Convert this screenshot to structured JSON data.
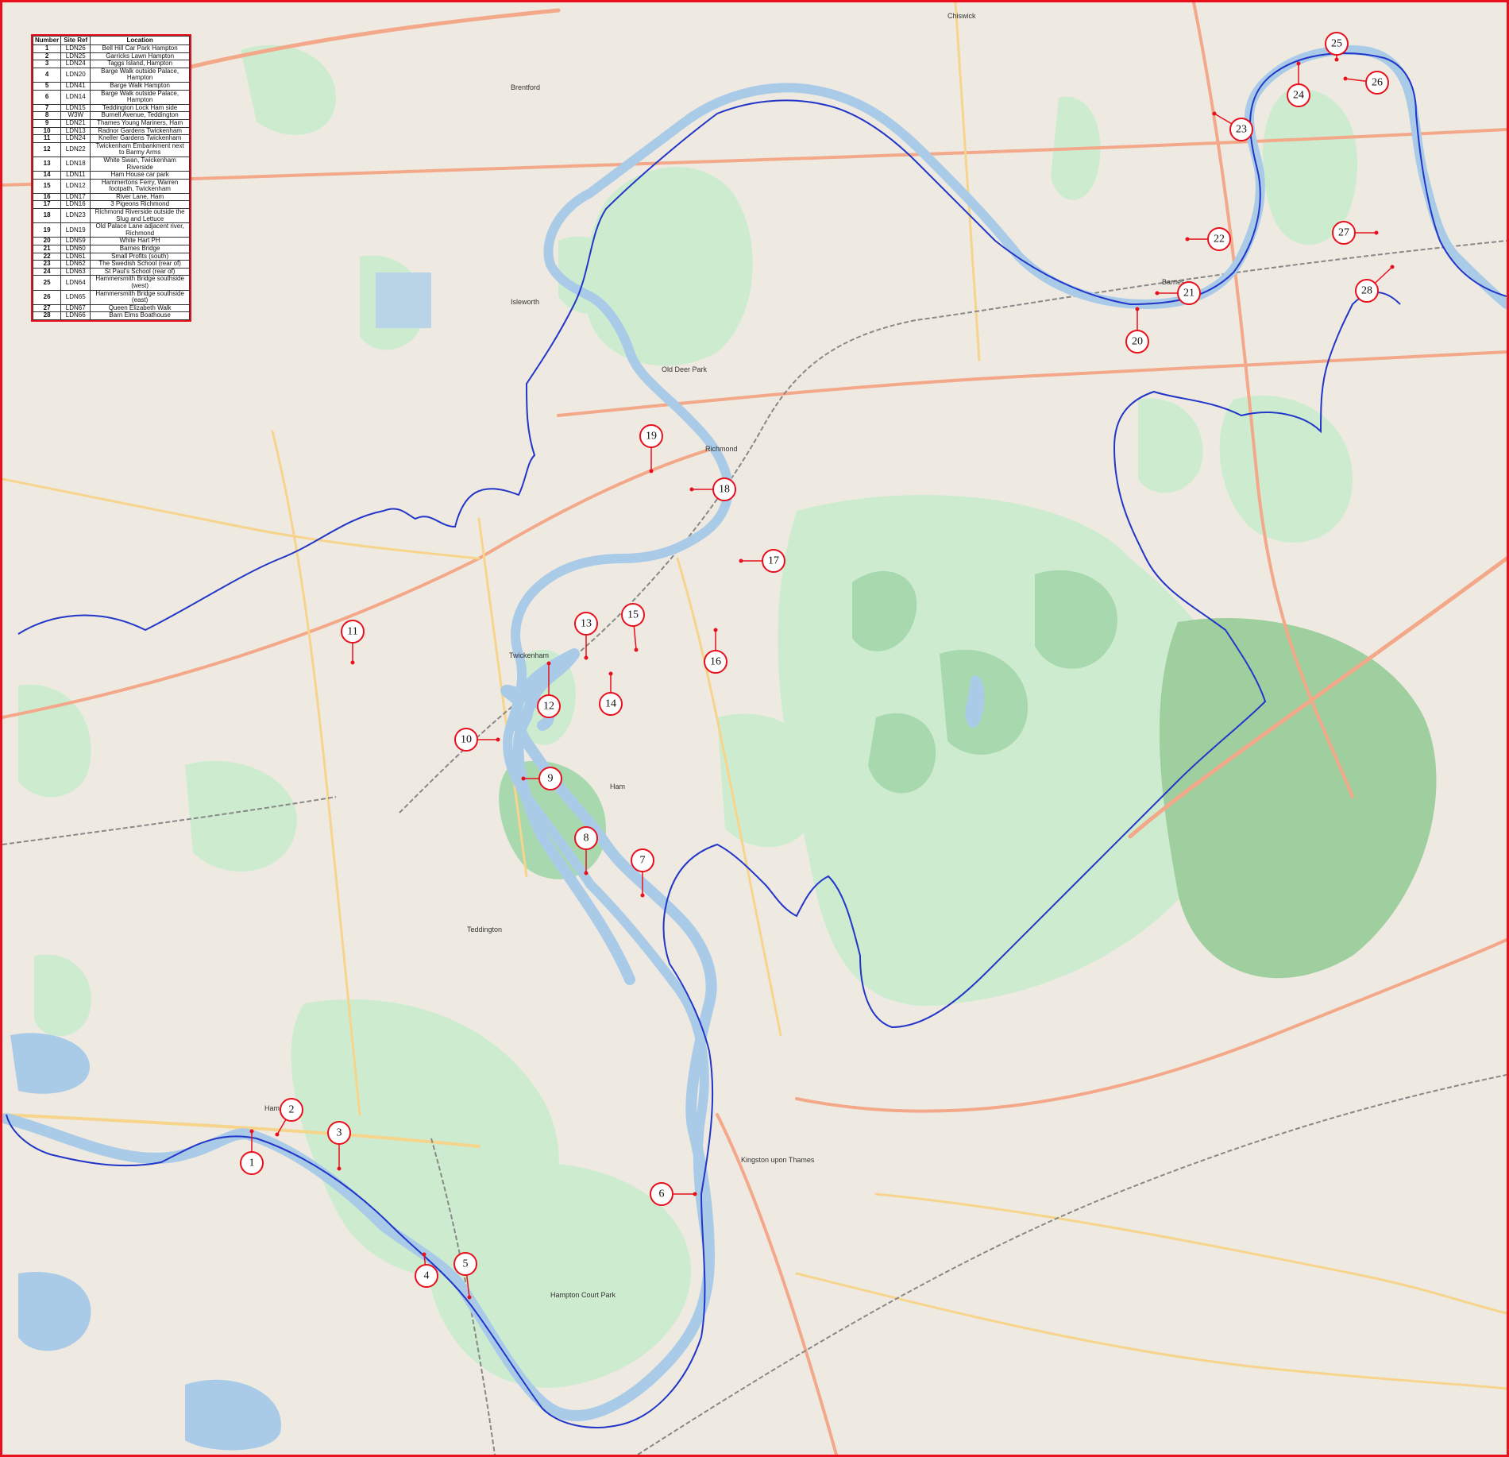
{
  "legend": {
    "headers": {
      "number": "Number",
      "site_ref": "Site Ref",
      "location": "Location"
    },
    "rows": [
      {
        "number": "1",
        "site_ref": "LDN26",
        "location": "Bell Hill Car Park Hampton"
      },
      {
        "number": "2",
        "site_ref": "LDN25",
        "location": "Garricks Lawn Hampton"
      },
      {
        "number": "3",
        "site_ref": "LDN24",
        "location": "Taggs Island, Hampton"
      },
      {
        "number": "4",
        "site_ref": "LDN20",
        "location": "Barge Walk outside Palace, Hampton"
      },
      {
        "number": "5",
        "site_ref": "LDN41",
        "location": "Barge Walk Hampton"
      },
      {
        "number": "6",
        "site_ref": "LDN14",
        "location": "Barge Walk outside Palace, Hampton"
      },
      {
        "number": "7",
        "site_ref": "LDN15",
        "location": "Teddington Lock Ham side"
      },
      {
        "number": "8",
        "site_ref": "W3W",
        "location": "Burnell Avenue, Teddington"
      },
      {
        "number": "9",
        "site_ref": "LDN21",
        "location": "Thames Young Mariners, Ham"
      },
      {
        "number": "10",
        "site_ref": "LDN13",
        "location": "Radnor Gardens Twickenham"
      },
      {
        "number": "11",
        "site_ref": "LDN24",
        "location": "Kneller Gardens Twickenham"
      },
      {
        "number": "12",
        "site_ref": "LDN22",
        "location": "Twickenham Embankment next to Barmy Arms"
      },
      {
        "number": "13",
        "site_ref": "LDN18",
        "location": "White Swan, Twickenham Riverside"
      },
      {
        "number": "14",
        "site_ref": "LDN11",
        "location": "Ham House car park"
      },
      {
        "number": "15",
        "site_ref": "LDN12",
        "location": "Hammertons Ferry, Warren footpath, Twickenham"
      },
      {
        "number": "16",
        "site_ref": "LDN17",
        "location": "River Lane, Ham"
      },
      {
        "number": "17",
        "site_ref": "LDN16",
        "location": "3 Pigeons Richmond"
      },
      {
        "number": "18",
        "site_ref": "LDN23",
        "location": "Richmond Riverside outside the Slug and Lettuce"
      },
      {
        "number": "19",
        "site_ref": "LDN19",
        "location": "Old Palace Lane adjacent river, Richmond"
      },
      {
        "number": "20",
        "site_ref": "LDN59",
        "location": "White Hart PH"
      },
      {
        "number": "21",
        "site_ref": "LDN60",
        "location": "Barnes Bridge"
      },
      {
        "number": "22",
        "site_ref": "LDN61",
        "location": "Small Profits (south)"
      },
      {
        "number": "23",
        "site_ref": "LDN62",
        "location": "The Swedish School (rear of)"
      },
      {
        "number": "24",
        "site_ref": "LDN63",
        "location": "St Paul's School (rear of)"
      },
      {
        "number": "25",
        "site_ref": "LDN64",
        "location": "Hammersmith Bridge southside (west)"
      },
      {
        "number": "26",
        "site_ref": "LDN65",
        "location": "Hammersmith Bridge southside (east)"
      },
      {
        "number": "27",
        "site_ref": "LDN67",
        "location": "Queen Elizabeth Walk"
      },
      {
        "number": "28",
        "site_ref": "LDN66",
        "location": "Barn Elms Boathouse"
      }
    ]
  },
  "markers": [
    {
      "label": "1"
    },
    {
      "label": "2"
    },
    {
      "label": "3"
    },
    {
      "label": "4"
    },
    {
      "label": "5"
    },
    {
      "label": "6"
    },
    {
      "label": "7"
    },
    {
      "label": "8"
    },
    {
      "label": "9"
    },
    {
      "label": "10"
    },
    {
      "label": "11"
    },
    {
      "label": "12"
    },
    {
      "label": "13"
    },
    {
      "label": "14"
    },
    {
      "label": "15"
    },
    {
      "label": "16"
    },
    {
      "label": "17"
    },
    {
      "label": "18"
    },
    {
      "label": "19"
    },
    {
      "label": "20"
    },
    {
      "label": "21"
    },
    {
      "label": "22"
    },
    {
      "label": "23"
    },
    {
      "label": "24"
    },
    {
      "label": "25"
    },
    {
      "label": "26"
    },
    {
      "label": "27"
    },
    {
      "label": "28"
    }
  ],
  "place_labels": {
    "chiswick": "Chiswick",
    "brentford": "Brentford",
    "isleworth": "Isleworth",
    "richmond": "Richmond",
    "twickenham": "Twickenham",
    "teddington": "Teddington",
    "hampton": "Hampton",
    "kingston": "Kingston upon Thames",
    "barnes": "Barnes",
    "ham": "Ham",
    "old_deer_park": "Old Deer Park",
    "hampton_court_park": "Hampton Court Park"
  },
  "colors": {
    "river": "#a9cbe8",
    "boundary": "#2236c8",
    "marker": "#e8101c",
    "park": "#cdeccf",
    "park_dark": "#a8d9ae",
    "woods": "#9fcf9f",
    "road_major": "#f4a88a",
    "road_minor": "#f7d48c",
    "frame": "#e8101c"
  }
}
